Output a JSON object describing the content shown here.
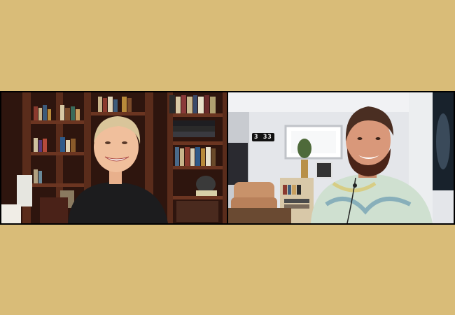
{
  "call": {
    "background_color": "#d9bc78",
    "separator_color": "#000000",
    "participants": [
      {
        "role": "host",
        "setting": "library-bookshelves"
      },
      {
        "role": "guest",
        "setting": "home-studio-room"
      }
    ],
    "wall_clock": {
      "text": "3 33"
    }
  }
}
